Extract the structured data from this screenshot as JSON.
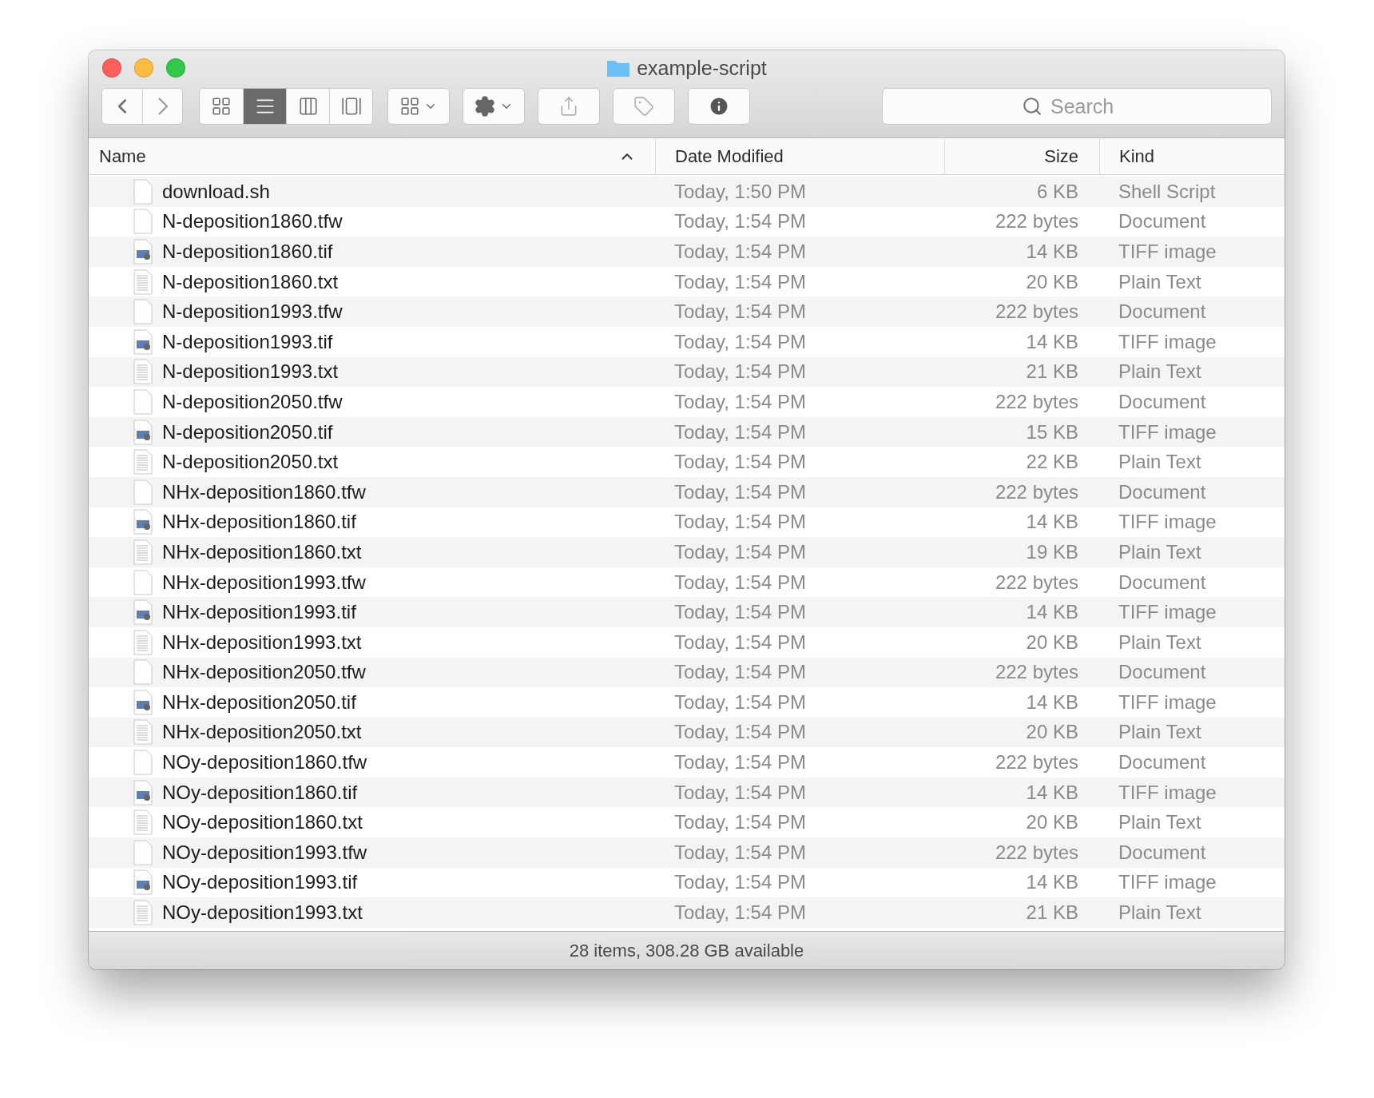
{
  "window": {
    "title": "example-script"
  },
  "toolbar": {
    "view_buttons": [
      {
        "selected": false
      },
      {
        "selected": true
      },
      {
        "selected": false
      },
      {
        "selected": false
      }
    ],
    "search": {
      "placeholder": "Search"
    }
  },
  "table": {
    "columns": [
      "Name",
      "Date Modified",
      "Size",
      "Kind"
    ],
    "rows": [
      {
        "kind": "blank",
        "name": "download.sh",
        "date": "Today, 1:50 PM",
        "size": "6 KB",
        "type": "Shell Script"
      },
      {
        "kind": "blank",
        "name": "N-deposition1860.tfw",
        "date": "Today, 1:54 PM",
        "size": "222 bytes",
        "type": "Document"
      },
      {
        "kind": "image",
        "name": "N-deposition1860.tif",
        "date": "Today, 1:54 PM",
        "size": "14 KB",
        "type": "TIFF image"
      },
      {
        "kind": "text",
        "name": "N-deposition1860.txt",
        "date": "Today, 1:54 PM",
        "size": "20 KB",
        "type": "Plain Text"
      },
      {
        "kind": "blank",
        "name": "N-deposition1993.tfw",
        "date": "Today, 1:54 PM",
        "size": "222 bytes",
        "type": "Document"
      },
      {
        "kind": "image",
        "name": "N-deposition1993.tif",
        "date": "Today, 1:54 PM",
        "size": "14 KB",
        "type": "TIFF image"
      },
      {
        "kind": "text",
        "name": "N-deposition1993.txt",
        "date": "Today, 1:54 PM",
        "size": "21 KB",
        "type": "Plain Text"
      },
      {
        "kind": "blank",
        "name": "N-deposition2050.tfw",
        "date": "Today, 1:54 PM",
        "size": "222 bytes",
        "type": "Document"
      },
      {
        "kind": "image",
        "name": "N-deposition2050.tif",
        "date": "Today, 1:54 PM",
        "size": "15 KB",
        "type": "TIFF image"
      },
      {
        "kind": "text",
        "name": "N-deposition2050.txt",
        "date": "Today, 1:54 PM",
        "size": "22 KB",
        "type": "Plain Text"
      },
      {
        "kind": "blank",
        "name": "NHx-deposition1860.tfw",
        "date": "Today, 1:54 PM",
        "size": "222 bytes",
        "type": "Document"
      },
      {
        "kind": "image",
        "name": "NHx-deposition1860.tif",
        "date": "Today, 1:54 PM",
        "size": "14 KB",
        "type": "TIFF image"
      },
      {
        "kind": "text",
        "name": "NHx-deposition1860.txt",
        "date": "Today, 1:54 PM",
        "size": "19 KB",
        "type": "Plain Text"
      },
      {
        "kind": "blank",
        "name": "NHx-deposition1993.tfw",
        "date": "Today, 1:54 PM",
        "size": "222 bytes",
        "type": "Document"
      },
      {
        "kind": "image",
        "name": "NHx-deposition1993.tif",
        "date": "Today, 1:54 PM",
        "size": "14 KB",
        "type": "TIFF image"
      },
      {
        "kind": "text",
        "name": "NHx-deposition1993.txt",
        "date": "Today, 1:54 PM",
        "size": "20 KB",
        "type": "Plain Text"
      },
      {
        "kind": "blank",
        "name": "NHx-deposition2050.tfw",
        "date": "Today, 1:54 PM",
        "size": "222 bytes",
        "type": "Document"
      },
      {
        "kind": "image",
        "name": "NHx-deposition2050.tif",
        "date": "Today, 1:54 PM",
        "size": "14 KB",
        "type": "TIFF image"
      },
      {
        "kind": "text",
        "name": "NHx-deposition2050.txt",
        "date": "Today, 1:54 PM",
        "size": "20 KB",
        "type": "Plain Text"
      },
      {
        "kind": "blank",
        "name": "NOy-deposition1860.tfw",
        "date": "Today, 1:54 PM",
        "size": "222 bytes",
        "type": "Document"
      },
      {
        "kind": "image",
        "name": "NOy-deposition1860.tif",
        "date": "Today, 1:54 PM",
        "size": "14 KB",
        "type": "TIFF image"
      },
      {
        "kind": "text",
        "name": "NOy-deposition1860.txt",
        "date": "Today, 1:54 PM",
        "size": "20 KB",
        "type": "Plain Text"
      },
      {
        "kind": "blank",
        "name": "NOy-deposition1993.tfw",
        "date": "Today, 1:54 PM",
        "size": "222 bytes",
        "type": "Document"
      },
      {
        "kind": "image",
        "name": "NOy-deposition1993.tif",
        "date": "Today, 1:54 PM",
        "size": "14 KB",
        "type": "TIFF image"
      },
      {
        "kind": "text",
        "name": "NOy-deposition1993.txt",
        "date": "Today, 1:54 PM",
        "size": "21 KB",
        "type": "Plain Text"
      }
    ]
  },
  "status_bar": "28 items, 308.28 GB available"
}
